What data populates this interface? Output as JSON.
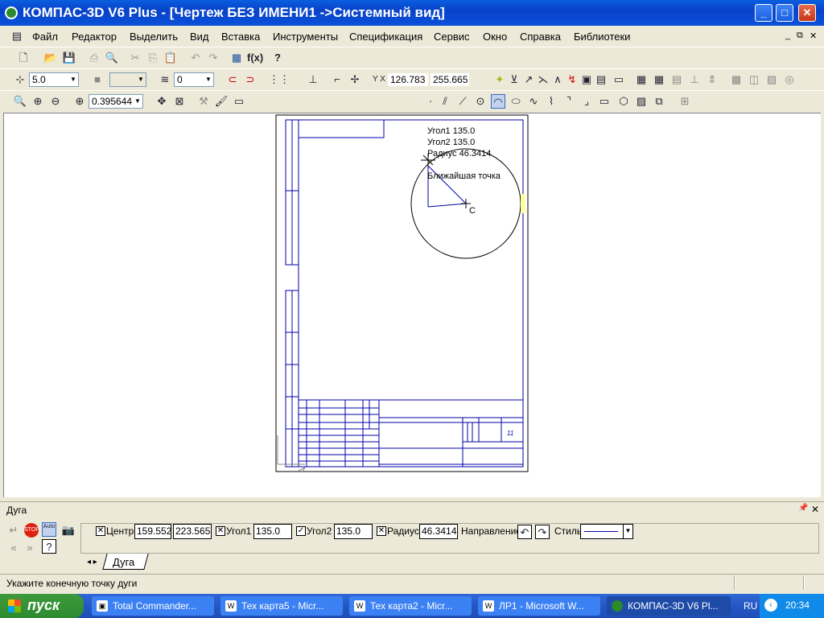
{
  "window": {
    "title": "КОМПАС-3D V6 Plus - [Чертеж БЕЗ ИМЕНИ1 ->Системный вид]",
    "minimize_glyph": "_",
    "maximize_glyph": "□",
    "close_glyph": "✕"
  },
  "menu": [
    "Файл",
    "Редактор",
    "Выделить",
    "Вид",
    "Вставка",
    "Инструменты",
    "Спецификация",
    "Сервис",
    "Окно",
    "Справка",
    "Библиотеки"
  ],
  "toolbar": {
    "line_width": "5.0",
    "layer": "0",
    "coord_x": "126.783",
    "coord_y": "255.665",
    "zoom": "0.395644"
  },
  "drawing": {
    "hint_angle1": "Угол1  135.0",
    "hint_angle2": "Угол2  135.0",
    "hint_radius": "Радиус 46.3414",
    "hint_snap": "Ближайшая точка",
    "cursor_label": "C",
    "sheet_number": "11"
  },
  "panel": {
    "title": "Дуга",
    "center_label": "Центр",
    "center_x": "159.552",
    "center_y": "223.565",
    "angle1_label": "Угол1",
    "angle1": "135.0",
    "angle2_label": "Угол2",
    "angle2": "135.0",
    "radius_label": "Радиус",
    "radius": "46.3414",
    "direction_label": "Направление",
    "style_label": "Стиль",
    "tab": "Дуга",
    "stop_label": "STOP",
    "auto_label": "Auto"
  },
  "status": "Укажите конечную точку дуги",
  "taskbar": {
    "start": "пуск",
    "tasks": [
      "Total Commander...",
      "Тех карта5 - Micr...",
      "Тех карта2 - Micr...",
      "ЛР1 - Microsoft W...",
      "КОМПАС-3D V6 Pl..."
    ],
    "lang": "RU",
    "time": "20:34"
  },
  "colors": {
    "titlebar": "#0a52dc",
    "frame_lines": "#0000a8",
    "taskbar": "#2457c4",
    "start": "#2f8a2f"
  }
}
